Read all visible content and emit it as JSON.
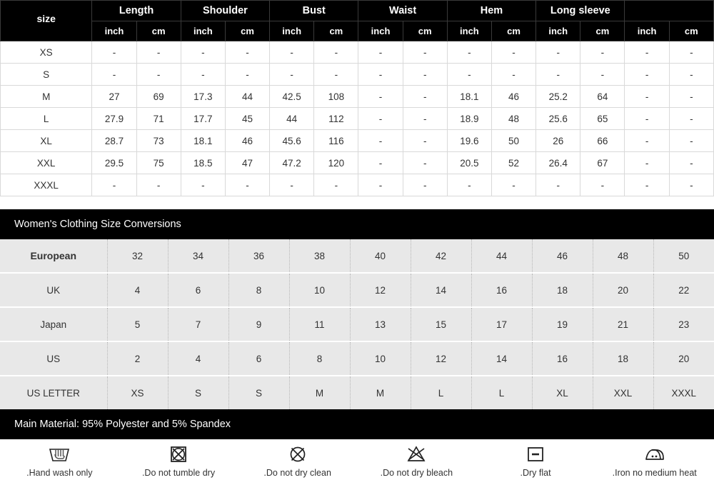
{
  "measurement_table": {
    "size_header": "size",
    "groups": [
      "Length",
      "Shoulder",
      "Bust",
      "Waist",
      "Hem",
      "Long sleeve",
      ""
    ],
    "unit_headers": [
      "inch",
      "cm",
      "inch",
      "cm",
      "inch",
      "cm",
      "inch",
      "cm",
      "inch",
      "cm",
      "inch",
      "cm",
      "inch",
      "cm"
    ],
    "rows": [
      {
        "size": "XS",
        "values": [
          "-",
          "-",
          "-",
          "-",
          "-",
          "-",
          "-",
          "-",
          "-",
          "-",
          "-",
          "-",
          "-",
          "-"
        ]
      },
      {
        "size": "S",
        "values": [
          "-",
          "-",
          "-",
          "-",
          "-",
          "-",
          "-",
          "-",
          "-",
          "-",
          "-",
          "-",
          "-",
          "-"
        ]
      },
      {
        "size": "M",
        "values": [
          "27",
          "69",
          "17.3",
          "44",
          "42.5",
          "108",
          "-",
          "-",
          "18.1",
          "46",
          "25.2",
          "64",
          "-",
          "-"
        ]
      },
      {
        "size": "L",
        "values": [
          "27.9",
          "71",
          "17.7",
          "45",
          "44",
          "112",
          "-",
          "-",
          "18.9",
          "48",
          "25.6",
          "65",
          "-",
          "-"
        ]
      },
      {
        "size": "XL",
        "values": [
          "28.7",
          "73",
          "18.1",
          "46",
          "45.6",
          "116",
          "-",
          "-",
          "19.6",
          "50",
          "26",
          "66",
          "-",
          "-"
        ]
      },
      {
        "size": "XXL",
        "values": [
          "29.5",
          "75",
          "18.5",
          "47",
          "47.2",
          "120",
          "-",
          "-",
          "20.5",
          "52",
          "26.4",
          "67",
          "-",
          "-"
        ]
      },
      {
        "size": "XXXL",
        "values": [
          "-",
          "-",
          "-",
          "-",
          "-",
          "-",
          "-",
          "-",
          "-",
          "-",
          "-",
          "-",
          "-",
          "-"
        ]
      }
    ]
  },
  "conversions": {
    "title": "Women's Clothing Size Conversions",
    "rows": [
      {
        "label": "European",
        "values": [
          "32",
          "34",
          "36",
          "38",
          "40",
          "42",
          "44",
          "46",
          "48",
          "50"
        ]
      },
      {
        "label": "UK",
        "values": [
          "4",
          "6",
          "8",
          "10",
          "12",
          "14",
          "16",
          "18",
          "20",
          "22"
        ]
      },
      {
        "label": "Japan",
        "values": [
          "5",
          "7",
          "9",
          "11",
          "13",
          "15",
          "17",
          "19",
          "21",
          "23"
        ]
      },
      {
        "label": "US",
        "values": [
          "2",
          "4",
          "6",
          "8",
          "10",
          "12",
          "14",
          "16",
          "18",
          "20"
        ]
      },
      {
        "label": "US LETTER",
        "values": [
          "XS",
          "S",
          "S",
          "M",
          "M",
          "L",
          "L",
          "XL",
          "XXL",
          "XXXL"
        ]
      }
    ]
  },
  "material": {
    "text": "Main Material:  95% Polyester and 5% Spandex"
  },
  "care_instructions": [
    {
      "icon": "hand-wash-icon",
      "label": ".Hand wash only"
    },
    {
      "icon": "no-tumble-dry-icon",
      "label": ".Do not tumble dry"
    },
    {
      "icon": "no-dry-clean-icon",
      "label": ".Do not dry clean"
    },
    {
      "icon": "no-bleach-icon",
      "label": ".Do not dry bleach"
    },
    {
      "icon": "dry-flat-icon",
      "label": ".Dry flat"
    },
    {
      "icon": "iron-medium-heat-icon",
      "label": ".Iron no medium heat"
    }
  ],
  "colors": {
    "header_bg": "#000000",
    "header_text": "#ffffff",
    "conv_row_bg": "#e8e8e8",
    "grid_line": "#d9d9d9"
  }
}
